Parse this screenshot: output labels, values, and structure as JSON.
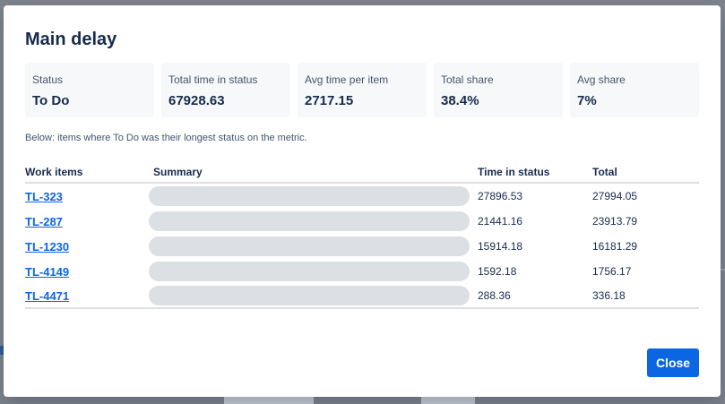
{
  "dialog": {
    "title": "Main delay",
    "stats": [
      {
        "label": "Status",
        "value": "To Do"
      },
      {
        "label": "Total time in status",
        "value": "67928.63"
      },
      {
        "label": "Avg time per item",
        "value": "2717.15"
      },
      {
        "label": "Total share",
        "value": "38.4%"
      },
      {
        "label": "Avg share",
        "value": "7%"
      }
    ],
    "note": "Below: items where To Do was their longest status on the metric.",
    "table": {
      "headers": {
        "key": "Work items",
        "summary": "Summary",
        "time": "Time in status",
        "total": "Total"
      },
      "rows": [
        {
          "key": "TL-323",
          "time": "27896.53",
          "total": "27994.05"
        },
        {
          "key": "TL-287",
          "time": "21441.16",
          "total": "23913.79"
        },
        {
          "key": "TL-1230",
          "time": "15914.18",
          "total": "16181.29"
        },
        {
          "key": "TL-4149",
          "time": "1592.18",
          "total": "1756.17"
        },
        {
          "key": "TL-4471",
          "time": "288.36",
          "total": "336.18"
        }
      ]
    },
    "close_label": "Close"
  },
  "colors": {
    "accent": "#0c66e4",
    "surface": "#f7f8f9",
    "overlay": "#7f848c"
  }
}
